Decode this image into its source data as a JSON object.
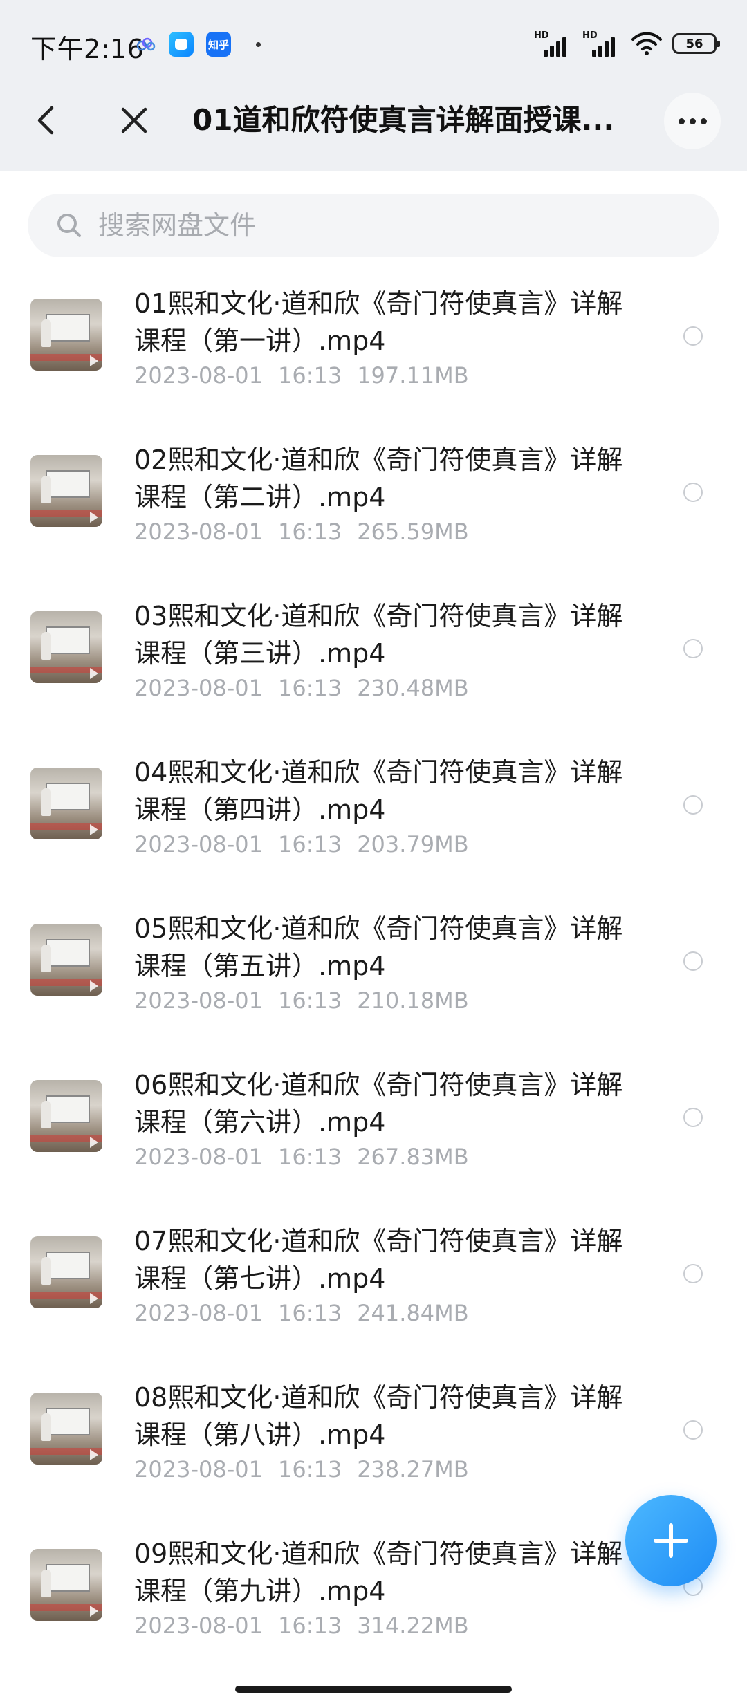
{
  "status_bar": {
    "time": "下午2:16",
    "zhihu_label": "知乎",
    "hd1": "HD",
    "hd2": "HD",
    "battery": "56"
  },
  "header": {
    "title": "01道和欣符使真言详解面授课..."
  },
  "search": {
    "placeholder": "搜索网盘文件"
  },
  "files": [
    {
      "name": "01熙和文化·道和欣《奇门符使真言》详解课程（第一讲）.mp4",
      "date": "2023-08-01",
      "time": "16:13",
      "size": "197.11MB"
    },
    {
      "name": "02熙和文化·道和欣《奇门符使真言》详解课程（第二讲）.mp4",
      "date": "2023-08-01",
      "time": "16:13",
      "size": "265.59MB"
    },
    {
      "name": "03熙和文化·道和欣《奇门符使真言》详解课程（第三讲）.mp4",
      "date": "2023-08-01",
      "time": "16:13",
      "size": "230.48MB"
    },
    {
      "name": "04熙和文化·道和欣《奇门符使真言》详解课程（第四讲）.mp4",
      "date": "2023-08-01",
      "time": "16:13",
      "size": "203.79MB"
    },
    {
      "name": "05熙和文化·道和欣《奇门符使真言》详解课程（第五讲）.mp4",
      "date": "2023-08-01",
      "time": "16:13",
      "size": "210.18MB"
    },
    {
      "name": "06熙和文化·道和欣《奇门符使真言》详解课程（第六讲）.mp4",
      "date": "2023-08-01",
      "time": "16:13",
      "size": "267.83MB"
    },
    {
      "name": "07熙和文化·道和欣《奇门符使真言》详解课程（第七讲）.mp4",
      "date": "2023-08-01",
      "time": "16:13",
      "size": "241.84MB"
    },
    {
      "name": "08熙和文化·道和欣《奇门符使真言》详解课程（第八讲）.mp4",
      "date": "2023-08-01",
      "time": "16:13",
      "size": "238.27MB"
    },
    {
      "name": "09熙和文化·道和欣《奇门符使真言》详解课程（第九讲）.mp4",
      "date": "2023-08-01",
      "time": "16:13",
      "size": "314.22MB"
    }
  ],
  "icons": {
    "back": "back-arrow-icon",
    "close": "close-icon",
    "more": "more-dots-icon",
    "search": "search-icon",
    "add": "plus-icon"
  },
  "colors": {
    "accent": "#1e8cf5",
    "header_bg": "#eef0f3",
    "meta_text": "#a9acb1"
  }
}
